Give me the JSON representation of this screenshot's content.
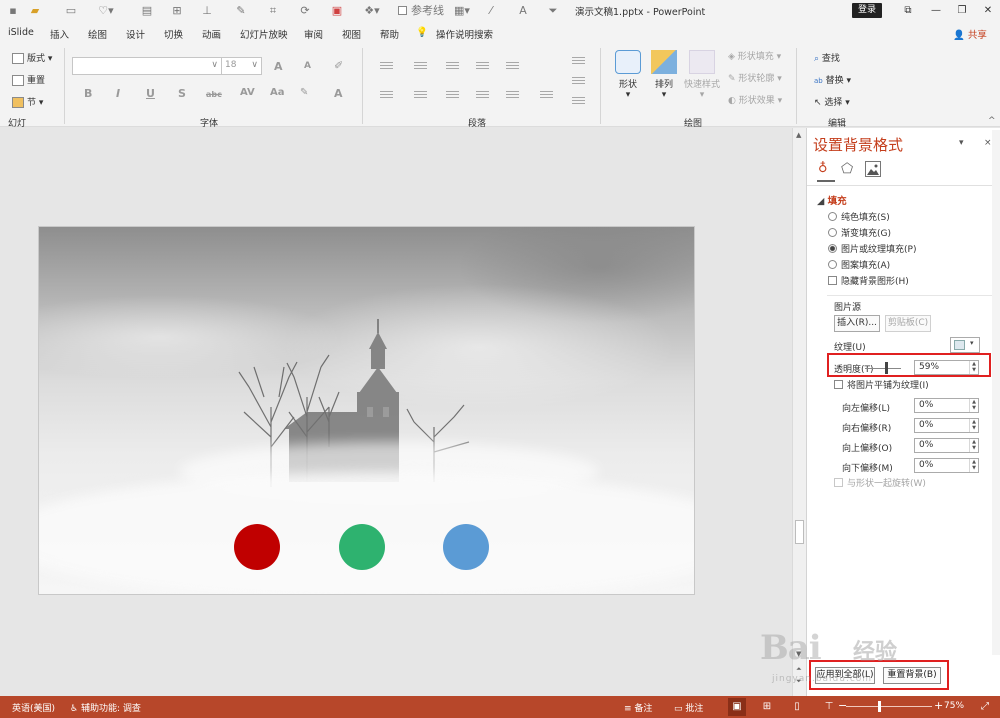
{
  "window": {
    "doc_title": "演示文稿1.pptx  -  PowerPoint",
    "login": "登录",
    "share": "共享",
    "qat_checkbox_label": "参考线",
    "qat_letter": "A"
  },
  "tabs": [
    "iSlide",
    "插入",
    "绘图",
    "设计",
    "切换",
    "动画",
    "幻灯片放映",
    "审阅",
    "视图",
    "帮助",
    "操作说明搜索"
  ],
  "ribbon": {
    "slides": {
      "layout": "版式",
      "reset": "重置",
      "section": "节",
      "label": "幻灯片"
    },
    "font": {
      "size": "18",
      "label": "字体",
      "bold": "B",
      "italic": "I",
      "underline": "U",
      "shadow": "S",
      "strike": "abc",
      "spacing": "AV",
      "case": "Aa",
      "color": "A",
      "grow": "A",
      "shrink": "A"
    },
    "paragraph": {
      "label": "段落"
    },
    "drawing": {
      "shapes": "形状",
      "arrange": "排列",
      "quick_styles": "快速样式",
      "fill": "形状填充",
      "outline": "形状轮廓",
      "effects": "形状效果",
      "label": "绘图"
    },
    "editing": {
      "find": "查找",
      "replace": "替换",
      "select": "选择",
      "label": "编辑"
    }
  },
  "slide": {
    "dots": [
      {
        "name": "red-circle",
        "color": "#c00000"
      },
      {
        "name": "green-circle",
        "color": "#2eb26f"
      },
      {
        "name": "blue-circle",
        "color": "#5b9bd5"
      }
    ]
  },
  "panel": {
    "title": "设置背景格式",
    "pin": "▾",
    "close": "×",
    "section": "填充",
    "fill_options": [
      {
        "label": "纯色填充(S)",
        "selected": false
      },
      {
        "label": "渐变填充(G)",
        "selected": false
      },
      {
        "label": "图片或纹理填充(P)",
        "selected": true
      },
      {
        "label": "图案填充(A)",
        "selected": false
      }
    ],
    "hide_bg": "隐藏背景图形(H)",
    "picture_source": "图片源",
    "insert_btn": "插入(R)...",
    "clipboard_btn": "剪贴板(C)",
    "texture": "纹理(U)",
    "transparency_label": "透明度(T)",
    "transparency_value": "59%",
    "transparency": 0.59,
    "tile": "将图片平铺为纹理(I)",
    "offsets": [
      {
        "label": "向左偏移(L)",
        "value": "0%"
      },
      {
        "label": "向右偏移(R)",
        "value": "0%"
      },
      {
        "label": "向上偏移(O)",
        "value": "0%"
      },
      {
        "label": "向下偏移(M)",
        "value": "0%"
      }
    ],
    "rotate": "与形状一起旋转(W)",
    "apply_all": "应用到全部(L)",
    "reset_bg": "重置背景(B)"
  },
  "status": {
    "language": "英语(美国)",
    "accessibility": "辅助功能: 调查",
    "notes": "备注",
    "comments": "批注",
    "zoom": "75%",
    "minus": "−",
    "plus": "+"
  },
  "watermark": {
    "main": "Bai",
    "cn": "经验",
    "url": "jingyan.baidu.com"
  }
}
